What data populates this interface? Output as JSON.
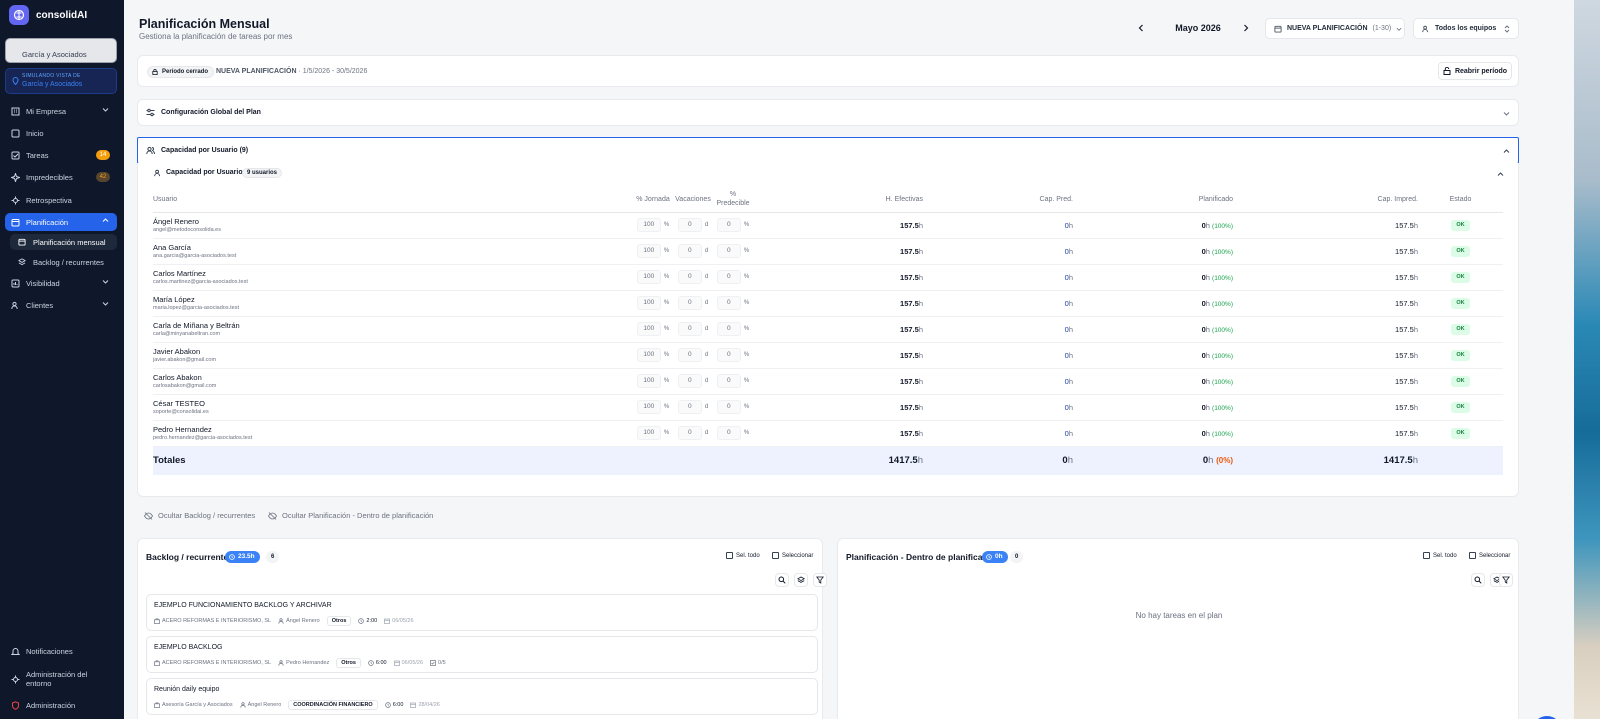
{
  "app": {
    "name": "consolidAI"
  },
  "sidebar": {
    "company": "García y Asociados",
    "simulating_label": "SIMULANDO VISTA DE",
    "simulating_value": "García y Asociados",
    "items": [
      {
        "label": "Mi Empresa",
        "icon": "building-icon"
      },
      {
        "label": "Inicio",
        "icon": "home-icon"
      },
      {
        "label": "Tareas",
        "icon": "check-square-icon",
        "badge": "14"
      },
      {
        "label": "Impredecibles",
        "icon": "sparkle-icon",
        "badge": "42"
      },
      {
        "label": "Retrospectiva",
        "icon": "gear-icon"
      },
      {
        "label": "Planificación",
        "icon": "calendar-icon"
      },
      {
        "label": "Planificación mensual",
        "icon": "calendar-icon"
      },
      {
        "label": "Backlog / recurrentes",
        "icon": "layers-icon"
      },
      {
        "label": "Visibilidad",
        "icon": "chart-icon"
      },
      {
        "label": "Clientes",
        "icon": "users-icon"
      }
    ],
    "bottom": [
      {
        "label": "Notificaciones",
        "icon": "bell-icon"
      },
      {
        "label": "Administración del entorno",
        "icon": "gear-icon"
      },
      {
        "label": "Administración",
        "icon": "shield-icon"
      }
    ]
  },
  "header": {
    "title": "Planificación Mensual",
    "subtitle": "Gestiona la planificación de tareas por mes",
    "month": "Mayo 2026",
    "plan_label": "NUEVA PLANIFICACIÓN",
    "plan_range": "(1-30)",
    "team": "Todos los equipos"
  },
  "period": {
    "status": "Período cerrado",
    "name": "NUEVA PLANIFICACIÓN",
    "dates": " · 1/5/2026 - 30/5/2026",
    "reopen": "Reabrir período"
  },
  "config": {
    "title": "Configuración Global del Plan"
  },
  "capacity": {
    "title": "Capacidad por Usuario (9)",
    "inner_title": "Capacidad por Usuario",
    "users_badge": "9 usuarios",
    "columns": {
      "user": "Usuario",
      "jornada": "% Jornada",
      "vacaciones": "Vacaciones",
      "predecible": "% Predecible",
      "h_efectivas": "H. Efectivas",
      "cap_pred": "Cap. Pred.",
      "planificado": "Planificado",
      "cap_impred": "Cap. Impred.",
      "estado": "Estado"
    },
    "rows": [
      {
        "name": "Ángel Renero",
        "email": "angel@metodoconsolida.es",
        "jornada": "100",
        "vac": "0",
        "pred": "0",
        "hef": "157.5",
        "cpred": "0",
        "plan": "0",
        "plan_pct": "(100%)",
        "cimp": "157.5",
        "estado": "OK"
      },
      {
        "name": "Ana García",
        "email": "ana.garcia@garcia-asociados.test",
        "jornada": "100",
        "vac": "0",
        "pred": "0",
        "hef": "157.5",
        "cpred": "0",
        "plan": "0",
        "plan_pct": "(100%)",
        "cimp": "157.5",
        "estado": "OK"
      },
      {
        "name": "Carlos Martínez",
        "email": "carlos.martinez@garcia-asociados.test",
        "jornada": "100",
        "vac": "0",
        "pred": "0",
        "hef": "157.5",
        "cpred": "0",
        "plan": "0",
        "plan_pct": "(100%)",
        "cimp": "157.5",
        "estado": "OK"
      },
      {
        "name": "María López",
        "email": "maria.lopez@garcia-asociados.test",
        "jornada": "100",
        "vac": "0",
        "pred": "0",
        "hef": "157.5",
        "cpred": "0",
        "plan": "0",
        "plan_pct": "(100%)",
        "cimp": "157.5",
        "estado": "OK"
      },
      {
        "name": "Carla de Miñana y Beltrán",
        "email": "carla@minyanabeltran.com",
        "jornada": "100",
        "vac": "0",
        "pred": "0",
        "hef": "157.5",
        "cpred": "0",
        "plan": "0",
        "plan_pct": "(100%)",
        "cimp": "157.5",
        "estado": "OK"
      },
      {
        "name": "Javier Abakon",
        "email": "javier.abakon@gmail.com",
        "jornada": "100",
        "vac": "0",
        "pred": "0",
        "hef": "157.5",
        "cpred": "0",
        "plan": "0",
        "plan_pct": "(100%)",
        "cimp": "157.5",
        "estado": "OK"
      },
      {
        "name": "Carlos Abakon",
        "email": "carlosabakon@gmail.com",
        "jornada": "100",
        "vac": "0",
        "pred": "0",
        "hef": "157.5",
        "cpred": "0",
        "plan": "0",
        "plan_pct": "(100%)",
        "cimp": "157.5",
        "estado": "OK"
      },
      {
        "name": "César TESTEO",
        "email": "soporte@consolidai.es",
        "jornada": "100",
        "vac": "0",
        "pred": "0",
        "hef": "157.5",
        "cpred": "0",
        "plan": "0",
        "plan_pct": "(100%)",
        "cimp": "157.5",
        "estado": "OK"
      },
      {
        "name": "Pedro Hernandez",
        "email": "pedro.hernandez@garcia-asociados.test",
        "jornada": "100",
        "vac": "0",
        "pred": "0",
        "hef": "157.5",
        "cpred": "0",
        "plan": "0",
        "plan_pct": "(100%)",
        "cimp": "157.5",
        "estado": "OK"
      }
    ],
    "units": {
      "pct": "%",
      "days": "d",
      "hours": "h"
    },
    "totals": {
      "label": "Totales",
      "hef": "1417.5",
      "cpred": "0",
      "plan": "0",
      "plan_pct": "(0%)",
      "cimp": "1417.5"
    }
  },
  "toggles": {
    "hide_backlog": "Ocultar Backlog / recurrentes",
    "hide_plan": "Ocultar Planificación - Dentro de planificación"
  },
  "backlog": {
    "title": "Backlog / recurrentes",
    "hours": "23.5h",
    "count": "6",
    "select_all": "Sel. todo",
    "select": "Seleccionar",
    "tasks": [
      {
        "title": "EJEMPLO FUNCIONAMIENTO BACKLOG Y ARCHIVAR",
        "client": "ACERO REFORMAS E INTERIORISMO, SL",
        "user": "Ángel Renero",
        "tag": "Otros",
        "time": "2:00",
        "date": "06/05/26",
        "count": ""
      },
      {
        "title": "EJEMPLO BACKLOG",
        "client": "ACERO REFORMAS E INTERIORISMO, SL",
        "user": "Pedro Hernandez",
        "tag": "Otros",
        "time": "6:00",
        "date": "06/05/26",
        "count": "0/5"
      },
      {
        "title": "Reunión daily equipo",
        "client": "Asesoría García y Asociados",
        "user": "Ángel Renero",
        "tag": "COORDINACIÓN FINANCIERO",
        "time": "6:00",
        "date": "28/04/26",
        "count": ""
      }
    ]
  },
  "planning": {
    "title": "Planificación - Dentro de planificación",
    "hours": "0h",
    "count": "0",
    "select_all": "Sel. todo",
    "select": "Seleccionar",
    "empty": "No hay tareas en el plan"
  }
}
